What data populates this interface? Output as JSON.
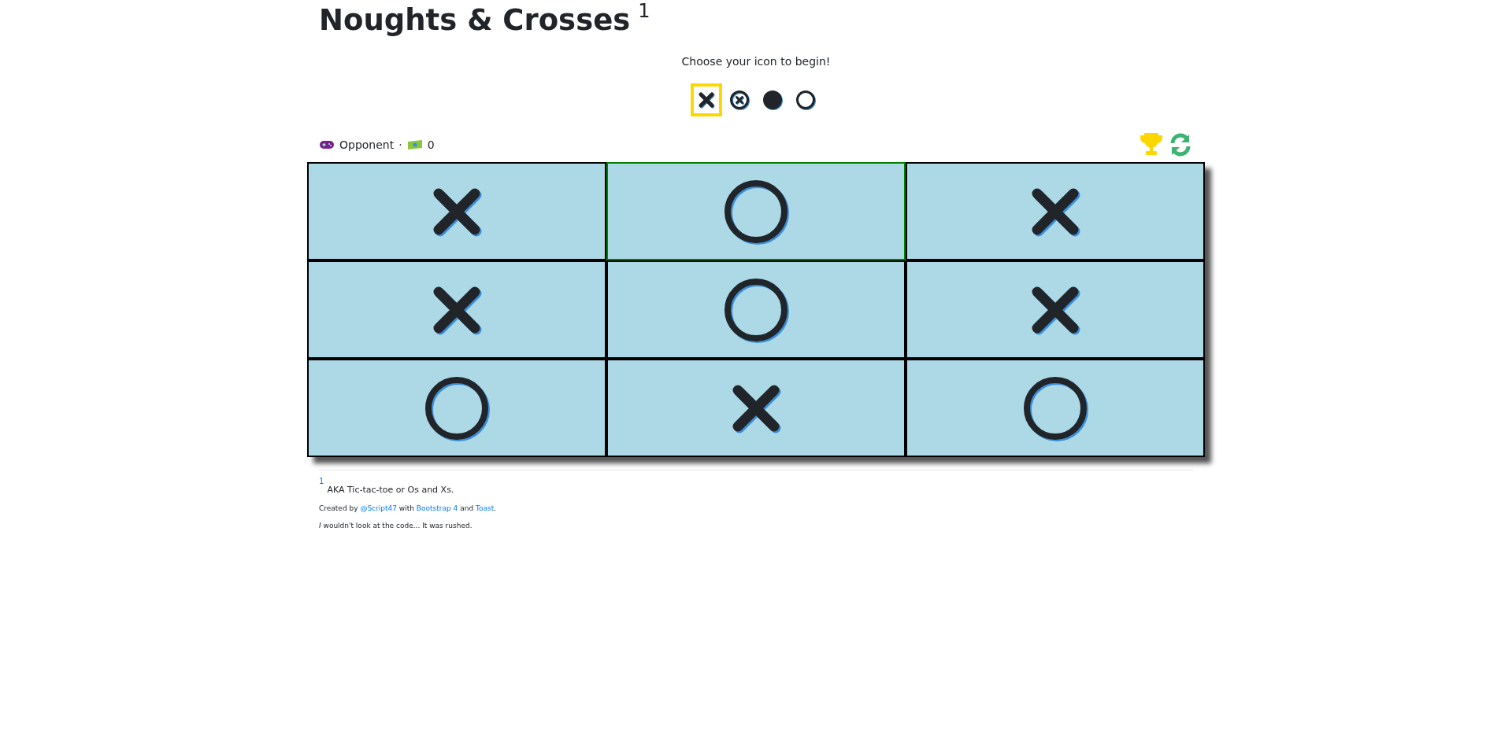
{
  "title": {
    "text": "Noughts & Crosses",
    "footnote_mark": "1"
  },
  "prompt": "Choose your icon to begin!",
  "icon_options": [
    {
      "kind": "cross",
      "selected": true
    },
    {
      "kind": "circled-cross",
      "selected": false
    },
    {
      "kind": "filled-circle",
      "selected": false
    },
    {
      "kind": "ring",
      "selected": false
    }
  ],
  "status": {
    "opponent": "Opponent",
    "separator": "·",
    "score": "0"
  },
  "board": [
    {
      "kind": "cross",
      "highlighted": false
    },
    {
      "kind": "circle",
      "highlighted": true
    },
    {
      "kind": "cross",
      "highlighted": false
    },
    {
      "kind": "cross",
      "highlighted": false
    },
    {
      "kind": "circle",
      "highlighted": false
    },
    {
      "kind": "cross",
      "highlighted": false
    },
    {
      "kind": "circle",
      "highlighted": false
    },
    {
      "kind": "cross",
      "highlighted": false
    },
    {
      "kind": "circle",
      "highlighted": false
    }
  ],
  "footnote": {
    "mark": "1",
    "text": "AKA Tic-tac-toe or Os and Xs."
  },
  "credits": {
    "prefix": "Created by",
    "author": "@Script47",
    "middle": "with",
    "lib1": "Bootstrap 4",
    "and": "and",
    "lib2": "Toast",
    "end": "."
  },
  "remark": "*I* wouldn't look at the code... It was rushed."
}
